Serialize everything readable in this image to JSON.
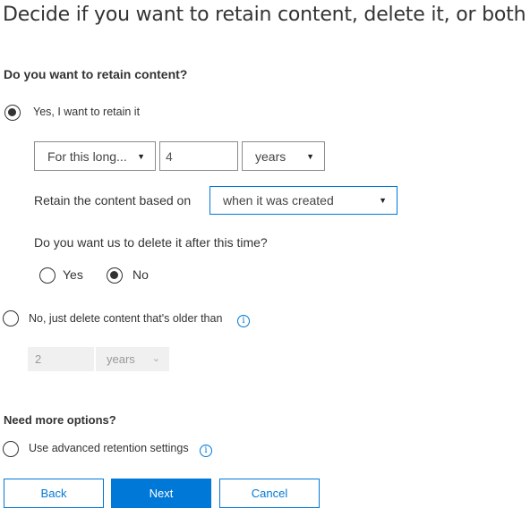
{
  "title": "Decide if you want to retain content, delete it, or both",
  "retain_section": {
    "heading": "Do you want to retain content?",
    "option_yes": {
      "label": "Yes, I want to retain it",
      "checked": true
    },
    "duration_type": {
      "value": "For this long...",
      "icon": "caret-down-icon"
    },
    "duration_value": "4",
    "duration_unit": {
      "value": "years",
      "icon": "caret-down-icon"
    },
    "based_on_label": "Retain the content based on",
    "based_on": {
      "value": "when it was created",
      "icon": "caret-down-icon"
    },
    "delete_after_question": "Do you want us to delete it after this time?",
    "delete_after_options": [
      {
        "label": "Yes",
        "checked": false
      },
      {
        "label": "No",
        "checked": true
      }
    ],
    "option_delete_only": {
      "label": "No, just delete content that's older than",
      "checked": false,
      "icon": "info-icon"
    },
    "delete_only_value": "2",
    "delete_only_unit": {
      "value": "years",
      "icon": "chevron-down-icon"
    }
  },
  "more_options": {
    "heading": "Need more options?",
    "advanced": {
      "label": "Use advanced retention settings",
      "checked": false,
      "icon": "info-icon"
    }
  },
  "buttons": {
    "back": "Back",
    "next": "Next",
    "cancel": "Cancel"
  },
  "colors": {
    "accent": "#0078d7",
    "text": "#333333",
    "disabled_bg": "#f0f0f0"
  },
  "glyphs": {
    "caret": "▼",
    "chevron": "﹀",
    "info": "i"
  }
}
